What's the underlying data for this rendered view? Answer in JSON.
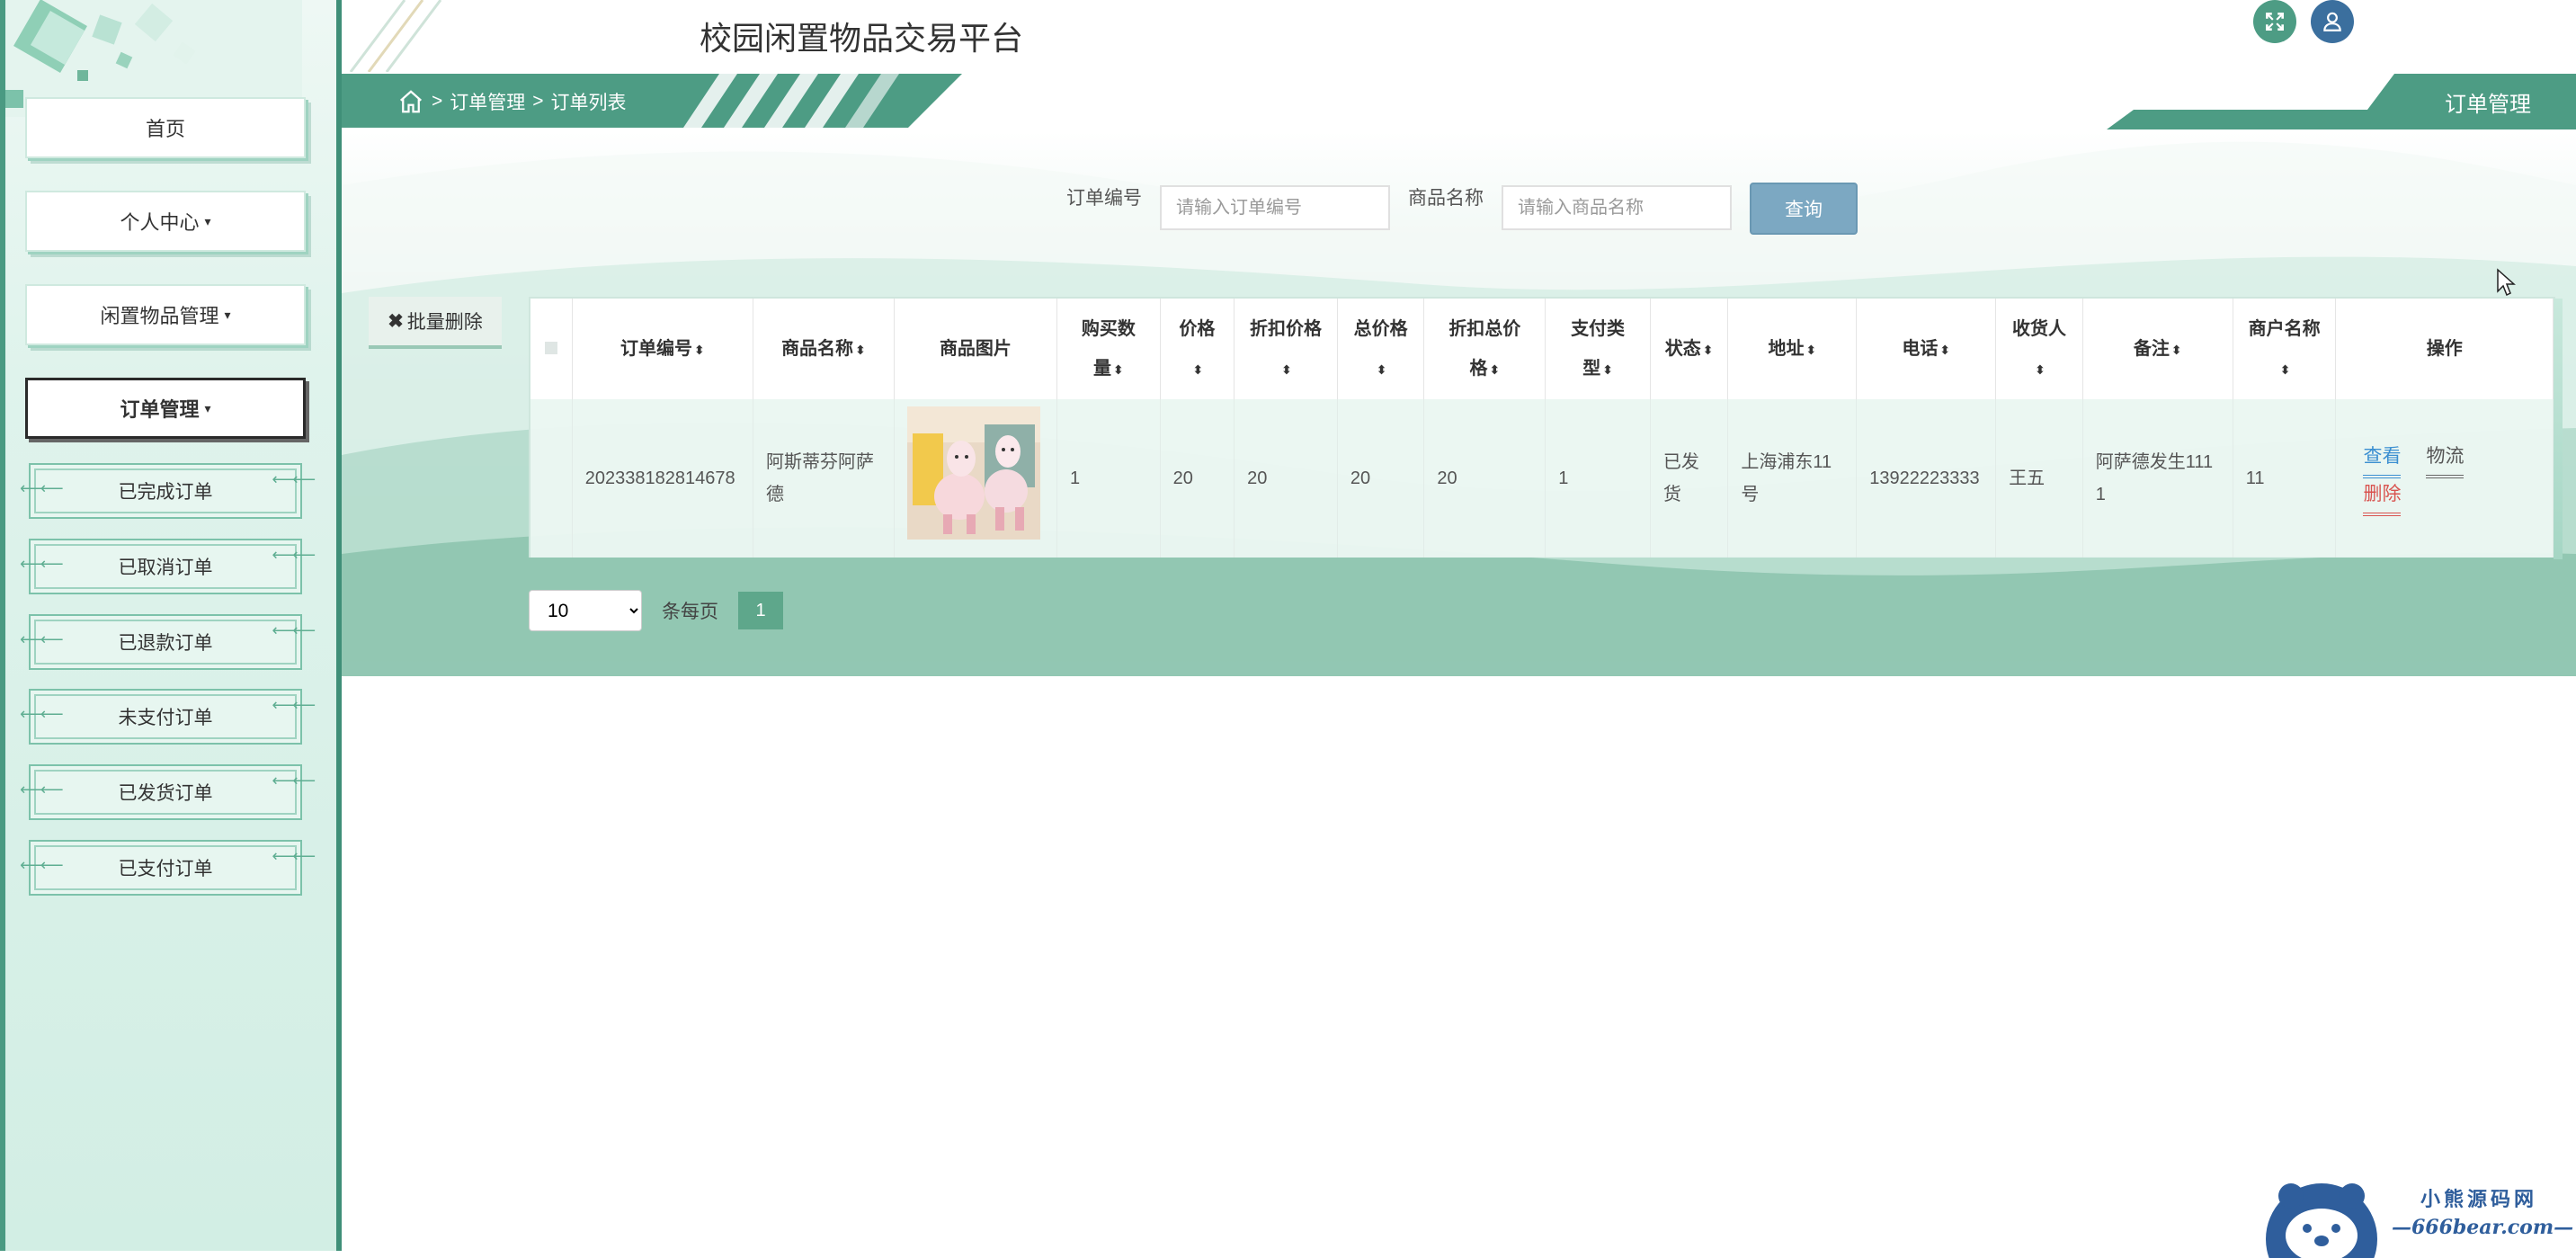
{
  "app": {
    "title": "校园闲置物品交易平台",
    "accent": "#4d9c84"
  },
  "sidebar": {
    "items": [
      {
        "label": "首页",
        "has_caret": false
      },
      {
        "label": "个人中心",
        "has_caret": true
      },
      {
        "label": "闲置物品管理",
        "has_caret": true
      },
      {
        "label": "订单管理",
        "has_caret": true,
        "active": true
      }
    ],
    "sub_items": [
      {
        "label": "已完成订单"
      },
      {
        "label": "已取消订单"
      },
      {
        "label": "已退款订单"
      },
      {
        "label": "未支付订单"
      },
      {
        "label": "已发货订单"
      },
      {
        "label": "已支付订单"
      }
    ]
  },
  "header": {
    "icons": [
      "fullscreen-icon",
      "user-icon"
    ]
  },
  "breadcrumb": {
    "separator": ">",
    "parent": "订单管理",
    "current": "订单列表"
  },
  "page_tag": "订单管理",
  "search": {
    "order_no_label": "订单编号",
    "order_no_placeholder": "请输入订单编号",
    "order_no_value": "",
    "goods_name_label": "商品名称",
    "goods_name_placeholder": "请输入商品名称",
    "goods_name_value": "",
    "query_label": "查询"
  },
  "toolbar": {
    "batch_delete_label": "批量删除"
  },
  "table": {
    "columns": [
      {
        "line1": "订单编号",
        "line2": ""
      },
      {
        "line1": "商品名称",
        "line2": ""
      },
      {
        "line1": "商品图片",
        "line2": ""
      },
      {
        "line1": "购买数",
        "line2": "量"
      },
      {
        "line1": "价格",
        "line2": ""
      },
      {
        "line1": "折扣价格",
        "line2": ""
      },
      {
        "line1": "总价格",
        "line2": ""
      },
      {
        "line1": "折扣总价",
        "line2": "格"
      },
      {
        "line1": "支付类",
        "line2": "型"
      },
      {
        "line1": "状态",
        "line2": ""
      },
      {
        "line1": "地址",
        "line2": ""
      },
      {
        "line1": "电话",
        "line2": ""
      },
      {
        "line1": "收货人",
        "line2": ""
      },
      {
        "line1": "备注",
        "line2": ""
      },
      {
        "line1": "商户名称",
        "line2": ""
      },
      {
        "line1": "操作",
        "line2": ""
      }
    ],
    "rows": [
      {
        "order_no": "202338182814678",
        "goods_name": "阿斯蒂芬阿萨德",
        "image": "plush-alpaca-toys",
        "quantity": "1",
        "price": "20",
        "discount_price": "20",
        "total_price": "20",
        "discount_total": "20",
        "pay_type": "1",
        "status": "已发货",
        "address": "上海浦东11号",
        "phone": "13922223333",
        "receiver": "王五",
        "remark": "阿萨德发生1111",
        "merchant": "11",
        "actions": {
          "view": "查看",
          "logistics": "物流",
          "delete": "删除"
        }
      }
    ]
  },
  "pagination": {
    "page_size": "10",
    "page_size_options": [
      "10"
    ],
    "per_page_label": "条每页",
    "current_page": "1"
  },
  "watermark": {
    "line1": "小熊源码网",
    "line2": "—666bear.com—"
  }
}
